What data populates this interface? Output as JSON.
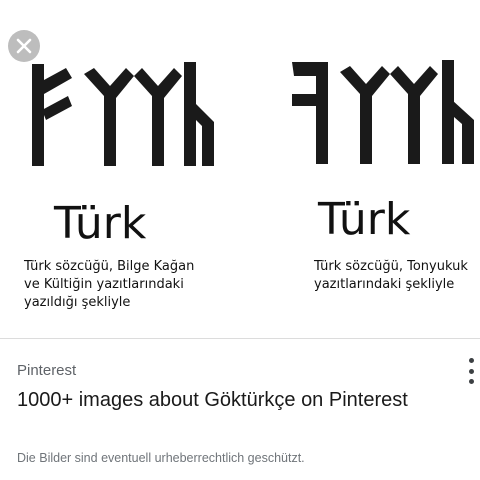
{
  "image": {
    "left_column": {
      "word": "Türk",
      "caption_lines": [
        "Türk sözcüğü, Bilge Kağan",
        "ve Kültiğin yazıtlarındaki",
        "yazıldığı şekliyle"
      ]
    },
    "right_column": {
      "word": "Türk",
      "caption_lines": [
        "Türk sözcüğü, Tonyukuk",
        "yazıtlarındaki şekliyle"
      ]
    },
    "close_icon": "close-icon"
  },
  "result": {
    "source": "Pinterest",
    "title": "1000+ images about Göktürkçe on Pinterest",
    "notice": "Die Bilder sind eventuell urheberrechtlich geschützt.",
    "more_icon": "more-vert-icon"
  }
}
